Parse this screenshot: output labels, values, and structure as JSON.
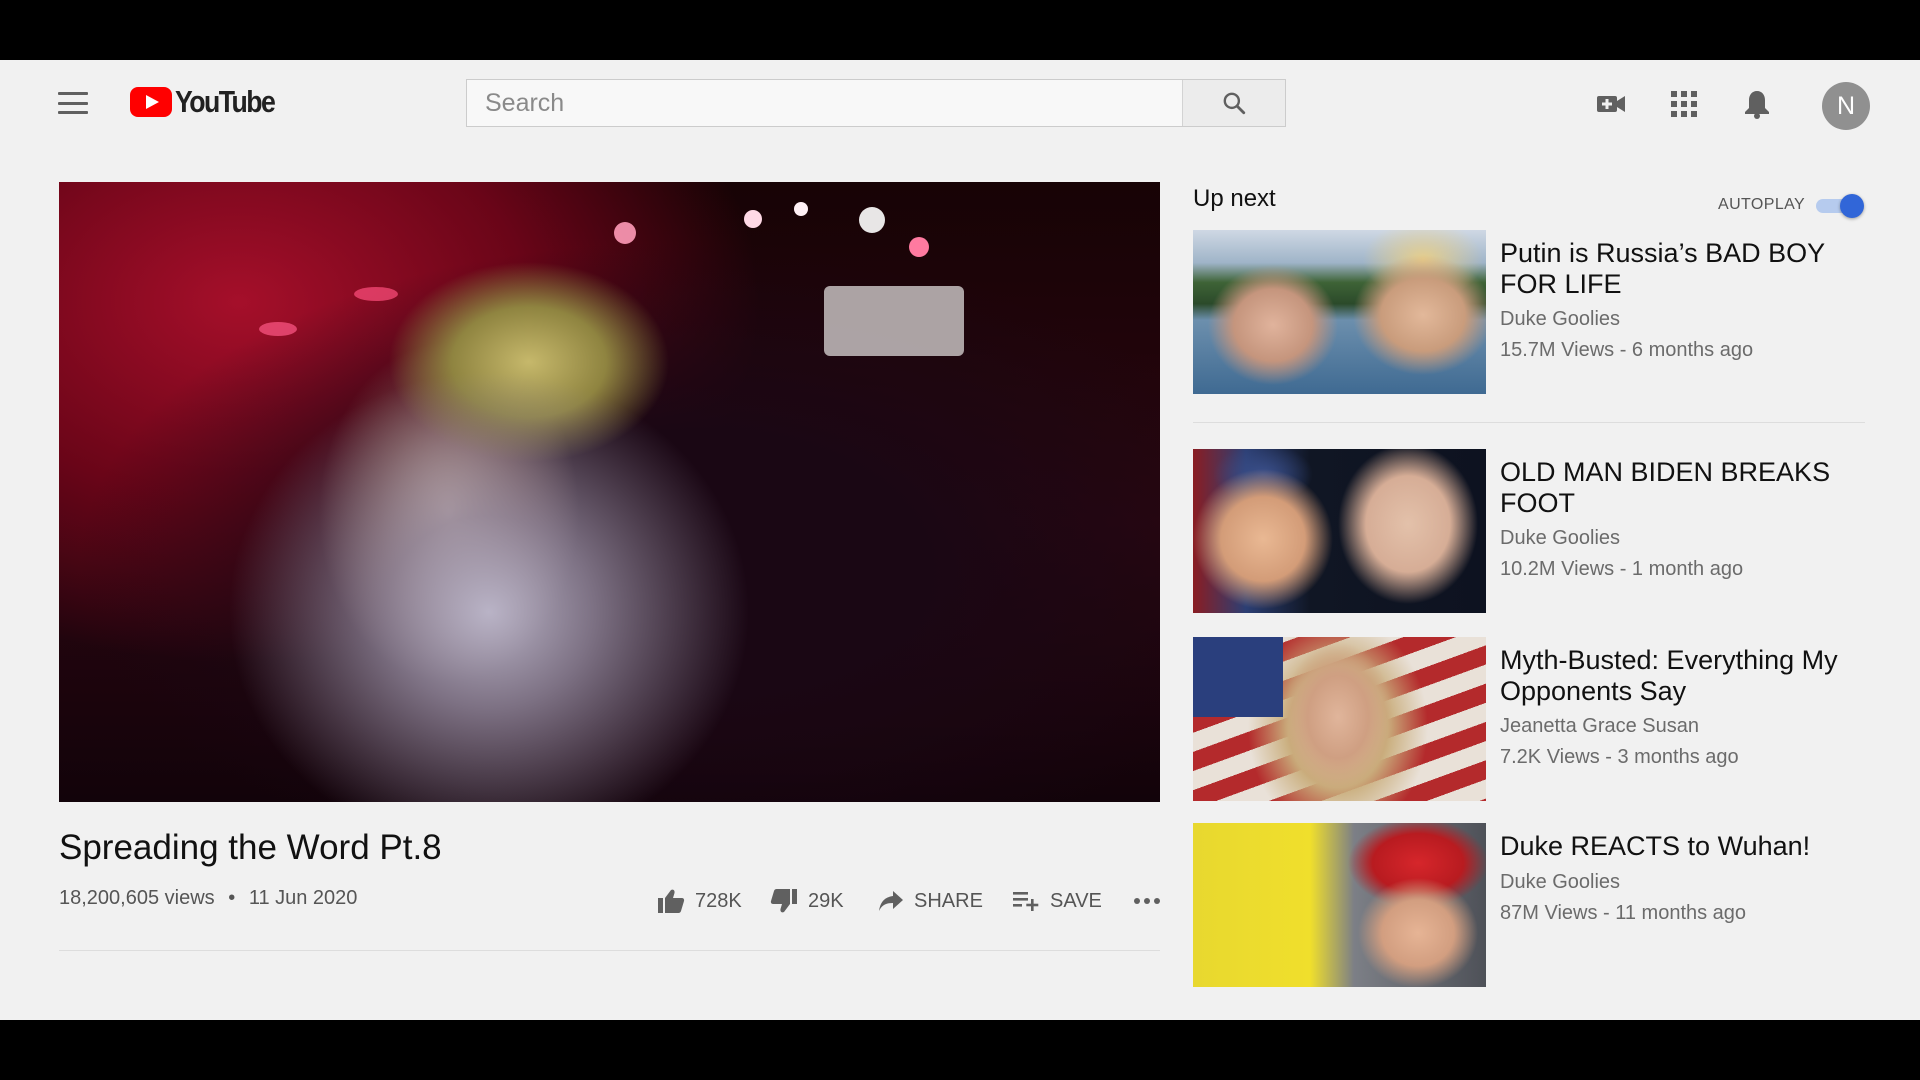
{
  "header": {
    "logo_text": "YouTube",
    "search_placeholder": "Search",
    "avatar_initial": "N",
    "icons": [
      "menu-icon",
      "youtube-logo",
      "search-icon",
      "create-video-icon",
      "apps-icon",
      "notifications-icon"
    ]
  },
  "video": {
    "title": "Spreading the Word Pt.8",
    "views": "18,200,605 views",
    "separator": "•",
    "date": "11 Jun 2020",
    "likes": "728K",
    "dislikes": "29K",
    "share_label": "SHARE",
    "save_label": "SAVE",
    "more_label": "..."
  },
  "sidebar": {
    "heading": "Up next",
    "autoplay_label": "AUTOPLAY",
    "autoplay_on": true,
    "items": [
      {
        "title": "Putin is Russia’s BAD BOY FOR LIFE",
        "channel": "Duke Goolies",
        "meta": "15.7M Views - 6 months ago"
      },
      {
        "title": "OLD MAN BIDEN BREAKS FOOT",
        "channel": "Duke Goolies",
        "meta": "10.2M Views - 1 month ago"
      },
      {
        "title": "Myth-Busted: Everything My Opponents Say",
        "channel": "Jeanetta Grace Susan",
        "meta": "7.2K Views - 3 months ago"
      },
      {
        "title": "Duke REACTS to Wuhan!",
        "channel": "Duke Goolies",
        "meta": "87M Views - 11 months ago"
      }
    ]
  },
  "colors": {
    "brand_red": "#ff0000",
    "toggle_blue": "#3166d8",
    "background": "#f1f1f1"
  }
}
